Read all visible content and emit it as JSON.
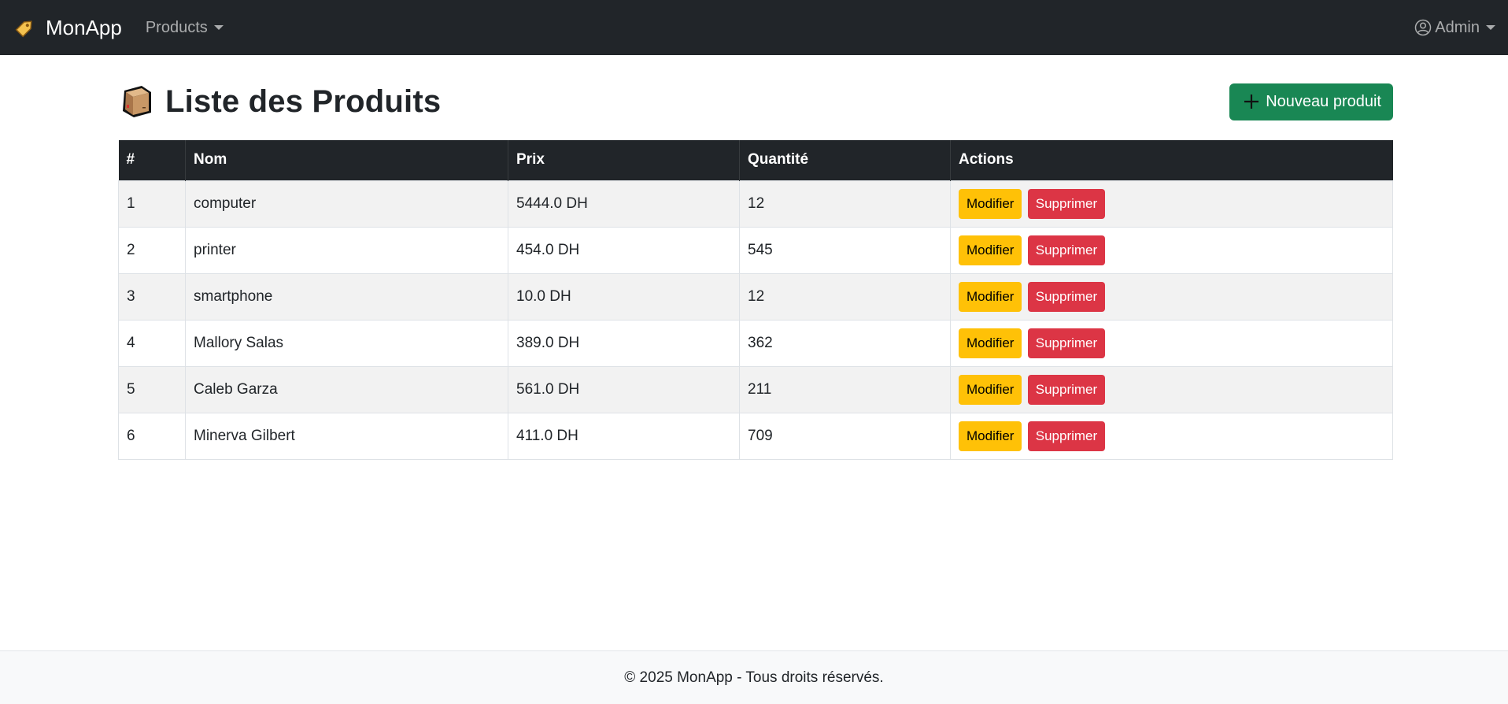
{
  "navbar": {
    "brand": "MonApp",
    "brand_icon": "tag-icon",
    "menu_label": "Products",
    "user_label": "Admin",
    "user_icon": "person-circle-icon"
  },
  "page": {
    "title": "Liste des Produits",
    "title_icon": "package-icon",
    "new_button": "Nouveau produit",
    "new_button_icon": "plus-icon"
  },
  "table": {
    "headers": [
      "#",
      "Nom",
      "Prix",
      "Quantité",
      "Actions"
    ],
    "rows": [
      {
        "id": "1",
        "nom": "computer",
        "prix": "5444.0 DH",
        "quantite": "12"
      },
      {
        "id": "2",
        "nom": "printer",
        "prix": "454.0 DH",
        "quantite": "545"
      },
      {
        "id": "3",
        "nom": "smartphone",
        "prix": "10.0 DH",
        "quantite": "12"
      },
      {
        "id": "4",
        "nom": "Mallory Salas",
        "prix": "389.0 DH",
        "quantite": "362"
      },
      {
        "id": "5",
        "nom": "Caleb Garza",
        "prix": "561.0 DH",
        "quantite": "211"
      },
      {
        "id": "6",
        "nom": "Minerva Gilbert",
        "prix": "411.0 DH",
        "quantite": "709"
      }
    ],
    "edit_label": "Modifier",
    "delete_label": "Supprimer"
  },
  "footer": {
    "text": "© 2025 MonApp - Tous droits réservés."
  },
  "colors": {
    "navbar": "#212529",
    "primary_success": "#198754",
    "warning": "#ffc107",
    "danger": "#dc3545",
    "footer_bg": "#f8f9fa"
  }
}
